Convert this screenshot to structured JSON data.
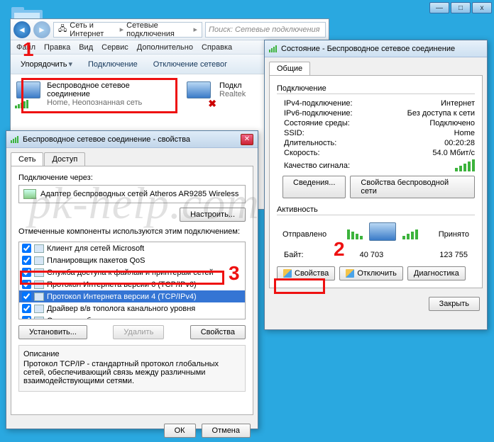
{
  "winframe": {
    "min": "—",
    "max": "□",
    "close": "x"
  },
  "explorer": {
    "crumb": {
      "a": "Сеть и Интернет",
      "b": "Сетевые подключения"
    },
    "search_placeholder": "Поиск: Сетевые подключения",
    "menu": [
      "Файл",
      "Правка",
      "Вид",
      "Сервис",
      "Дополнительно",
      "Справка"
    ],
    "toolbar": {
      "organize": "Упорядочить",
      "connect": "Подключение",
      "disconnect": "Отключение сетевог"
    },
    "conn1": {
      "title": "Беспроводное сетевое соединение",
      "sub": "Home, Неопознанная сеть"
    },
    "conn2": {
      "title": "Подкл",
      "sub": "Realtek"
    }
  },
  "props": {
    "title": "Беспроводное сетевое соединение - свойства",
    "tab_net": "Сеть",
    "tab_access": "Доступ",
    "connect_via": "Подключение через:",
    "adapter": "Адаптер беспроводных сетей Atheros AR9285 Wireless",
    "configure": "Настроить...",
    "marked": "Отмеченные компоненты используются этим подключением:",
    "items": [
      "Клиент для сетей Microsoft",
      "Планировщик пакетов QoS",
      "Служба доступа к файлам и принтерам сетей",
      "Протокол Интернета версии 6 (TCP/IPv6)",
      "Протокол Интернета версии 4 (TCP/IPv4)",
      "Драйвер в/в тополога канального уровня",
      "Ответчик обнаружения топологии канального уровня"
    ],
    "install": "Установить...",
    "remove": "Удалить",
    "properties": "Свойства",
    "desc_h": "Описание",
    "desc": "Протокол TCP/IP - стандартный протокол глобальных сетей, обеспечивающий связь между различными взаимодействующими сетями.",
    "ok": "ОК",
    "cancel": "Отмена"
  },
  "status": {
    "title": "Состояние - Беспроводное сетевое соединение",
    "tab": "Общие",
    "grp_conn": "Подключение",
    "rows": [
      {
        "k": "IPv4-подключение:",
        "v": "Интернет"
      },
      {
        "k": "IPv6-подключение:",
        "v": "Без доступа к сети"
      },
      {
        "k": "Состояние среды:",
        "v": "Подключено"
      },
      {
        "k": "SSID:",
        "v": "Home"
      },
      {
        "k": "Длительность:",
        "v": "00:20:28"
      },
      {
        "k": "Скорость:",
        "v": "54.0 Мбит/с"
      }
    ],
    "signal": "Качество сигнала:",
    "details": "Сведения...",
    "wprops": "Свойства беспроводной сети",
    "grp_act": "Активность",
    "sent": "Отправлено",
    "recv": "Принято",
    "bytes_lbl": "Байт:",
    "bytes_sent": "40 703",
    "bytes_recv": "123 755",
    "btn_props": "Свойства",
    "btn_disc": "Отключить",
    "btn_diag": "Диагностика",
    "close": "Закрыть"
  },
  "marks": {
    "n1": "1",
    "n2": "2",
    "n3": "3"
  },
  "watermark": "pk-help.com"
}
